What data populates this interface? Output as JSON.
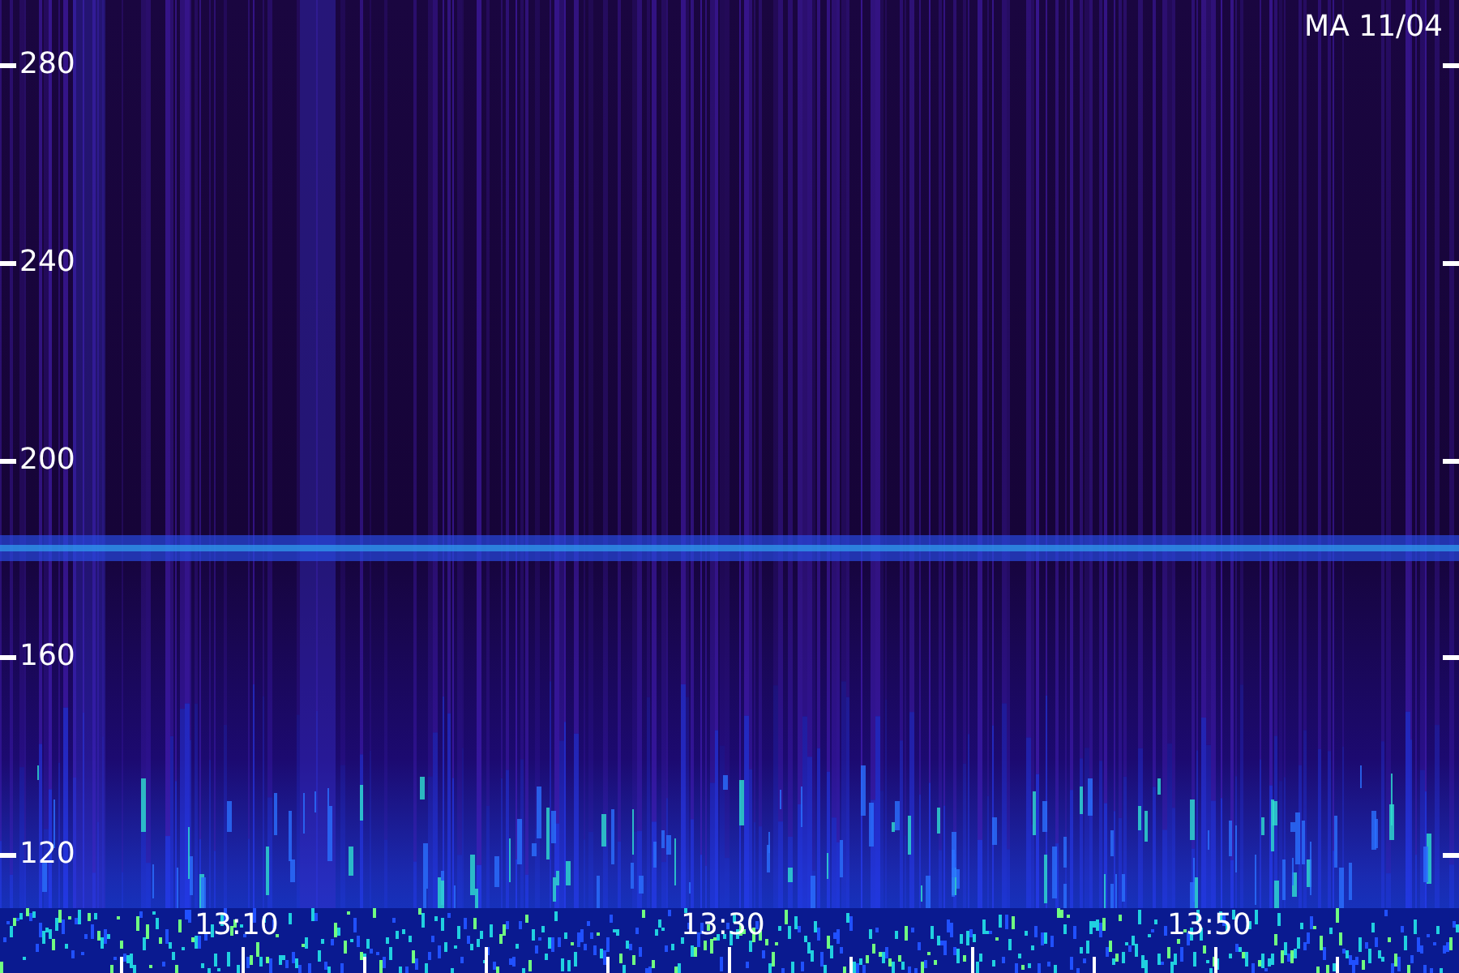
{
  "title": "MA 11/04",
  "y_axis_labels": [
    "280",
    "240",
    "200",
    "160",
    "120"
  ],
  "x_axis_labels": [
    "13:10",
    "13:30",
    "13:50"
  ]
}
